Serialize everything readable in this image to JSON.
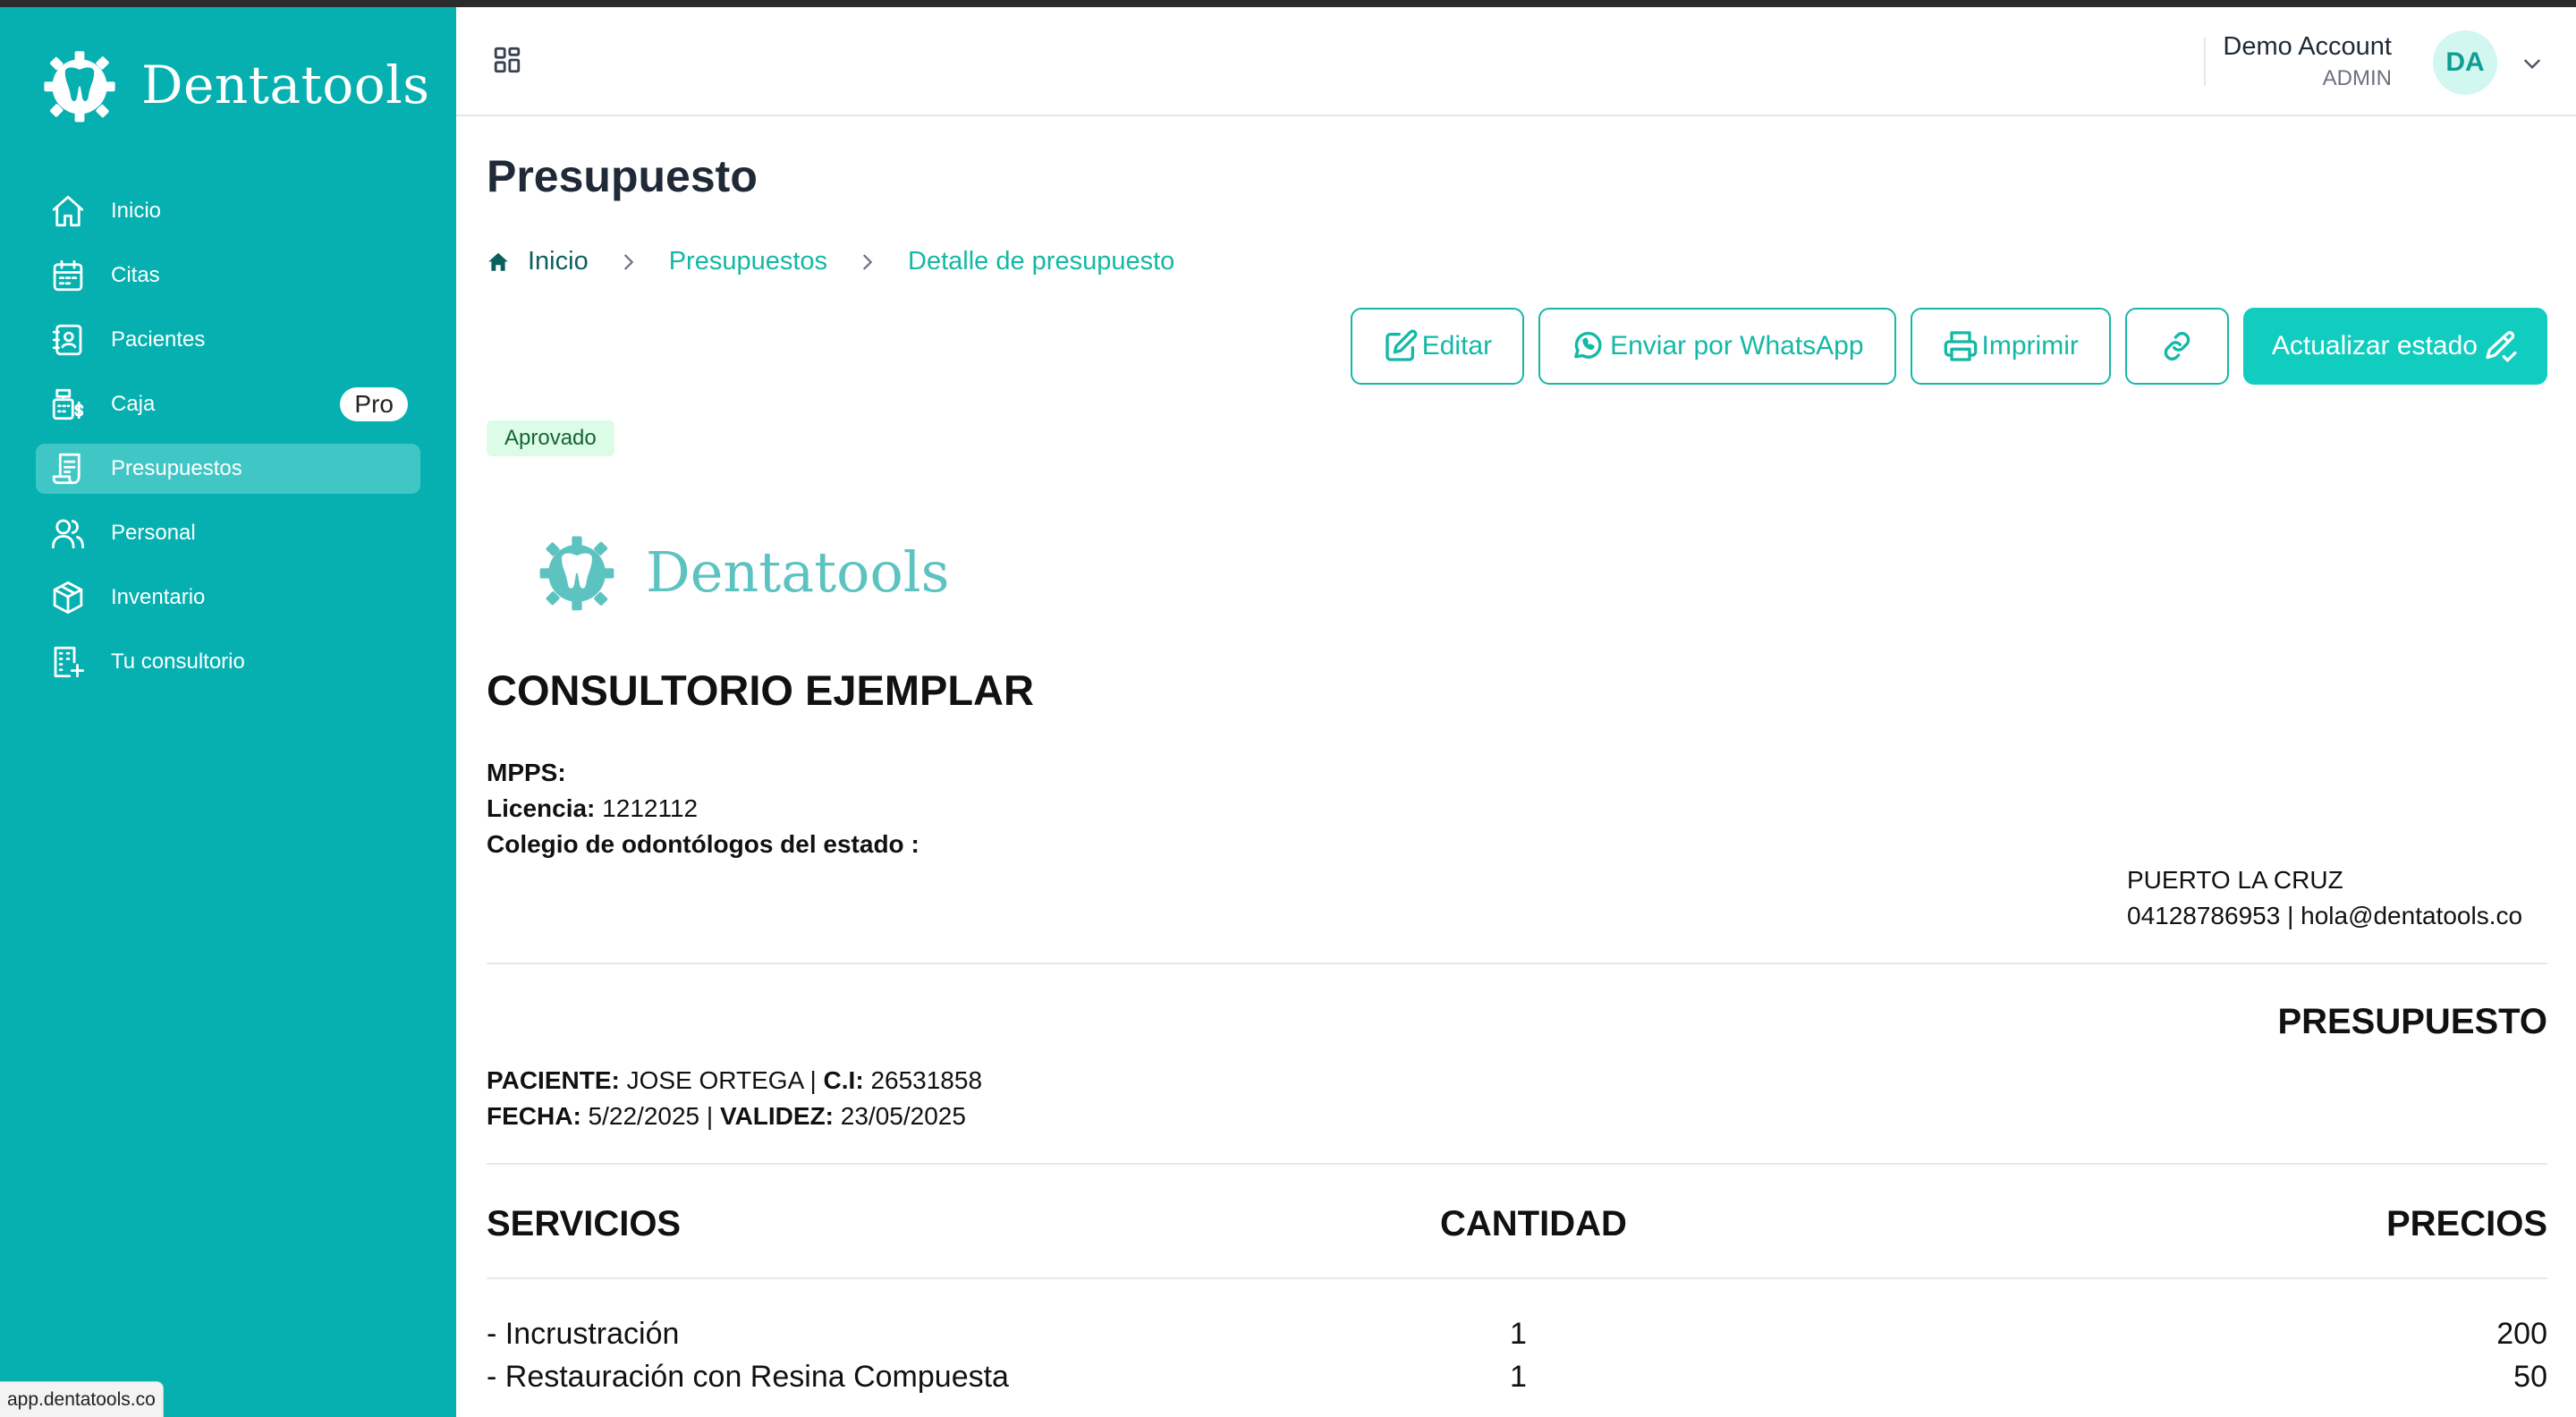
{
  "app": {
    "brand_name": "Dentatools",
    "status_url": "app.dentatools.co"
  },
  "sidebar": {
    "items": [
      {
        "label": "Inicio",
        "icon": "home-icon",
        "active": false
      },
      {
        "label": "Citas",
        "icon": "calendar-icon",
        "active": false
      },
      {
        "label": "Pacientes",
        "icon": "contacts-icon",
        "active": false
      },
      {
        "label": "Caja",
        "icon": "cash-register-icon",
        "active": false,
        "badge": "Pro"
      },
      {
        "label": "Presupuestos",
        "icon": "receipt-icon",
        "active": true
      },
      {
        "label": "Personal",
        "icon": "users-icon",
        "active": false
      },
      {
        "label": "Inventario",
        "icon": "box-icon",
        "active": false
      },
      {
        "label": "Tu consultorio",
        "icon": "building-icon",
        "active": false
      }
    ]
  },
  "header": {
    "user_name": "Demo Account",
    "user_role": "ADMIN",
    "avatar_initials": "DA"
  },
  "page": {
    "title": "Presupuesto",
    "breadcrumb": [
      "Inicio",
      "Presupuestos",
      "Detalle de presupuesto"
    ],
    "actions": {
      "edit": "Editar",
      "whatsapp": "Enviar por WhatsApp",
      "print": "Imprimir",
      "update_status": "Actualizar estado"
    },
    "status": "Aprovado"
  },
  "document": {
    "logo_name": "Dentatools",
    "clinic_name": "CONSULTORIO EJEMPLAR",
    "mpps_label": "MPPS:",
    "license_label": "Licencia:",
    "license_value": "1212112",
    "college_label": "Colegio de odontólogos del estado :",
    "city": "PUERTO LA CRUZ",
    "contact": "04128786953 | hola@dentatools.co",
    "doc_type": "PRESUPUESTO",
    "patient_label": "PACIENTE:",
    "patient_name": "JOSE ORTEGA",
    "ci_label": "C.I:",
    "ci_value": "26531858",
    "date_label": "FECHA:",
    "date_value": "5/22/2025",
    "validity_label": "VALIDEZ:",
    "validity_value": "23/05/2025",
    "columns": [
      "SERVICIOS",
      "CANTIDAD",
      "PRECIOS"
    ],
    "rows": [
      {
        "service": "- Incrustración",
        "qty": "1",
        "price": "200"
      },
      {
        "service": "- Restauración con Resina Compuesta",
        "qty": "1",
        "price": "50"
      }
    ]
  },
  "colors": {
    "sidebar": "#06b0b0",
    "accent": "#14b8a6",
    "primary_button": "#11cdc0",
    "badge_bg": "#dcfce7"
  }
}
